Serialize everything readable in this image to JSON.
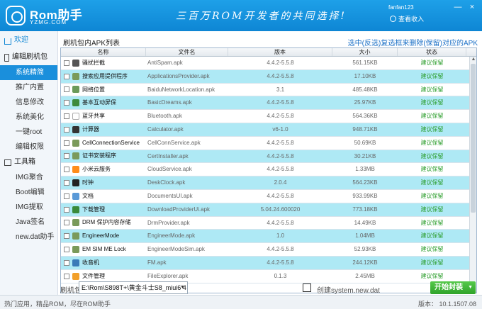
{
  "header": {
    "logo": "Rom助手",
    "logo_sub": "YZMG.COM",
    "slogan": "三百万ROM开发者的共同选择!",
    "username": "fanfan123",
    "login": "查看收入",
    "controls": [
      "—",
      "×"
    ]
  },
  "sidebar": {
    "welcome": "欢迎",
    "group1": "编辑刷机包",
    "group1_items": [
      "系统精简",
      "推广内置",
      "信息修改",
      "系统美化",
      "一键root",
      "编辑权限"
    ],
    "group2": "工具箱",
    "group2_items": [
      "IMG聚合",
      "Boot编辑",
      "IMG提取",
      "Java签名",
      "new.dat助手"
    ]
  },
  "main": {
    "title": "刷机包内APK列表",
    "hint": "选中(反选)复选框来删除(保留)对应的APK",
    "columns": [
      "名称",
      "文件名",
      "版本",
      "大小",
      "状态"
    ],
    "rows": [
      {
        "name": "骚扰拦截",
        "file": "AntiSpam.apk",
        "version": "4.4.2-5.5.8",
        "size": "561.15KB",
        "status": "建议保留",
        "icon": "#555555"
      },
      {
        "name": "搜索应用提供程序",
        "file": "ApplicationsProvider.apk",
        "version": "4.4.2-5.5.8",
        "size": "17.10KB",
        "status": "建议保留",
        "icon": "#7a9a5a"
      },
      {
        "name": "网络位置",
        "file": "BaiduNetworkLocation.apk",
        "version": "3.1",
        "size": "485.48KB",
        "status": "建议保留",
        "icon": "#6a9a5a"
      },
      {
        "name": "基本互动屏保",
        "file": "BasicDreams.apk",
        "version": "4.4.2-5.5.8",
        "size": "25.97KB",
        "status": "建议保留",
        "icon": "#3c8a3c"
      },
      {
        "name": "蓝牙共享",
        "file": "Bluetooth.apk",
        "version": "4.4.2-5.5.8",
        "size": "564.36KB",
        "status": "建议保留",
        "icon": "#ffffff"
      },
      {
        "name": "计算器",
        "file": "Calculator.apk",
        "version": "v6-1.0",
        "size": "948.71KB",
        "status": "建议保留",
        "icon": "#333333"
      },
      {
        "name": "CellConnectionService",
        "file": "CellConnService.apk",
        "version": "4.4.2-5.5.8",
        "size": "50.69KB",
        "status": "建议保留",
        "icon": "#7a9a5a"
      },
      {
        "name": "证书安装程序",
        "file": "CertInstaller.apk",
        "version": "4.4.2-5.5.8",
        "size": "30.21KB",
        "status": "建议保留",
        "icon": "#7a9a5a"
      },
      {
        "name": "小米云服务",
        "file": "CloudService.apk",
        "version": "4.4.2-5.5.8",
        "size": "1.33MB",
        "status": "建议保留",
        "icon": "#ff8c1a"
      },
      {
        "name": "时钟",
        "file": "DeskClock.apk",
        "version": "2.0.4",
        "size": "564.23KB",
        "status": "建议保留",
        "icon": "#222222"
      },
      {
        "name": "文档",
        "file": "DocumentsUI.apk",
        "version": "4.4.2-5.5.8",
        "size": "933.99KB",
        "status": "建议保留",
        "icon": "#5a9ad8"
      },
      {
        "name": "下载管理",
        "file": "DownloadProviderUi.apk",
        "version": "5.04.24.600020",
        "size": "773.18KB",
        "status": "建议保留",
        "icon": "#3a8a3a"
      },
      {
        "name": "DRM 保护内容存储",
        "file": "DrmProvider.apk",
        "version": "4.4.2-5.5.8",
        "size": "14.49KB",
        "status": "建议保留",
        "icon": "#7a9a5a"
      },
      {
        "name": "EngineerMode",
        "file": "EngineerMode.apk",
        "version": "1.0",
        "size": "1.04MB",
        "status": "建议保留",
        "icon": "#7a9a5a"
      },
      {
        "name": "EM SIM ME Lock",
        "file": "EngineerModeSim.apk",
        "version": "4.4.2-5.5.8",
        "size": "52.93KB",
        "status": "建议保留",
        "icon": "#7a9a5a"
      },
      {
        "name": "收音机",
        "file": "FM.apk",
        "version": "4.4.2-5.5.8",
        "size": "244.12KB",
        "status": "建议保留",
        "icon": "#3a7ab8"
      },
      {
        "name": "文件管理",
        "file": "FileExplorer.apk",
        "version": "0.1.3",
        "size": "2.45MB",
        "status": "建议保留",
        "icon": "#f2a02a"
      }
    ]
  },
  "controls": {
    "pkg_label": "刷机包",
    "pkg_value": "E:\\Rom\\S898T+\\黄金斗士S8_miui6 4",
    "dat_label": "创建system.new.dat",
    "start_label": "开始封装"
  },
  "status": {
    "left": "热门应用，精品ROM，尽在ROM助手",
    "right": "版本： 10.1.1507.08"
  }
}
